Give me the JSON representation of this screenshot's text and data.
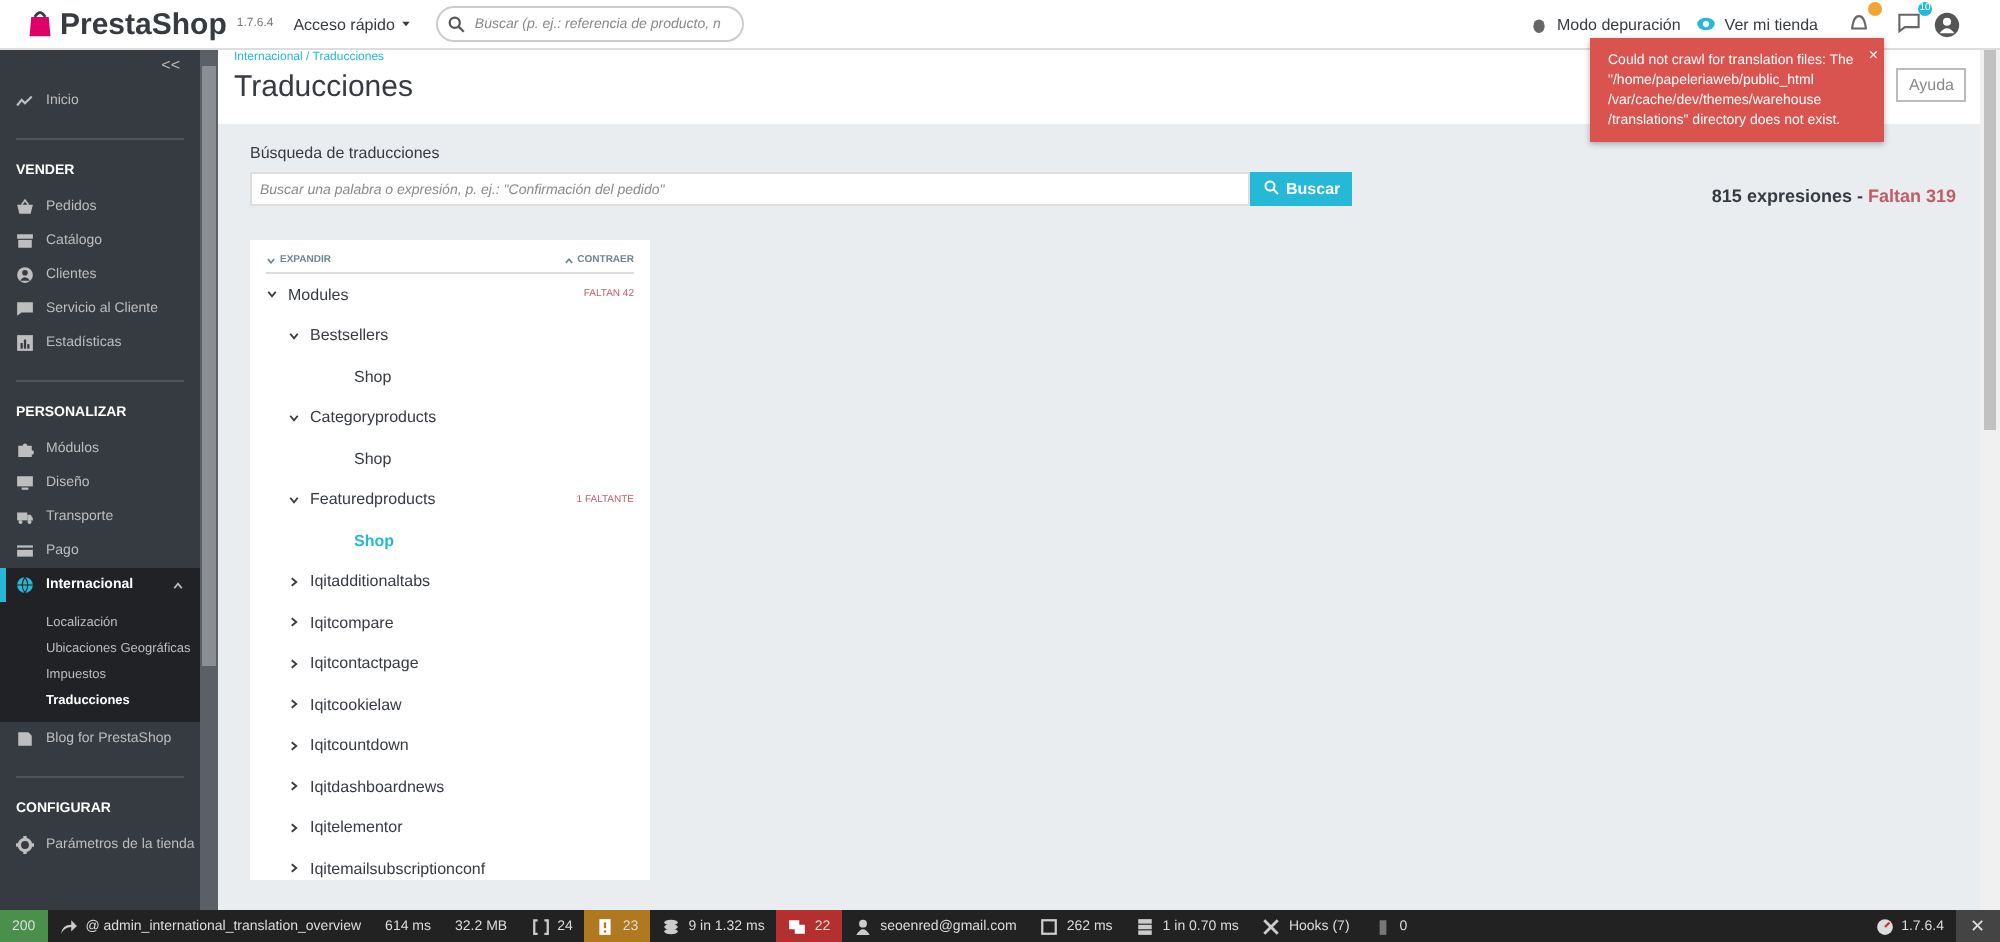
{
  "header": {
    "logo": "PrestaShop",
    "version": "1.7.6.4",
    "quick_access": "Acceso rápido",
    "search": {
      "placeholder": "Buscar (p. ej.: referencia de producto, n"
    },
    "debug_mode": "Modo depuración",
    "view_store": "Ver mi tienda",
    "notifications": [
      {
        "kind": "bell"
      },
      {
        "kind": "chat",
        "count": "10"
      }
    ]
  },
  "sidebar": {
    "collapse": "<<",
    "items": [
      {
        "kind": "item",
        "label": "Inicio",
        "selected": false
      },
      {
        "kind": "section",
        "label": "VENDER"
      },
      {
        "kind": "item",
        "label": "Pedidos",
        "selected": false
      },
      {
        "kind": "item",
        "label": "Catálogo",
        "selected": false
      },
      {
        "kind": "item",
        "label": "Clientes",
        "selected": false
      },
      {
        "kind": "item",
        "label": "Servicio al Cliente",
        "selected": false
      },
      {
        "kind": "item",
        "label": "Estadísticas",
        "selected": false
      },
      {
        "kind": "section",
        "label": "PERSONALIZAR"
      },
      {
        "kind": "item",
        "label": "Módulos",
        "selected": false
      },
      {
        "kind": "item",
        "label": "Diseño",
        "selected": false
      },
      {
        "kind": "item",
        "label": "Transporte",
        "selected": false
      },
      {
        "kind": "item",
        "label": "Pago",
        "selected": false
      },
      {
        "kind": "item",
        "label": "Internacional",
        "selected": true,
        "expanded": true,
        "children": [
          {
            "label": "Localización",
            "selected": false
          },
          {
            "label": "Ubicaciones Geográficas",
            "selected": false
          },
          {
            "label": "Impuestos",
            "selected": false
          },
          {
            "label": "Traducciones",
            "selected": true
          }
        ]
      },
      {
        "kind": "item",
        "label": "Blog for PrestaShop",
        "selected": false
      },
      {
        "kind": "section",
        "label": "CONFIGURAR"
      },
      {
        "kind": "item",
        "label": "Parámetros de la tienda",
        "selected": false
      }
    ]
  },
  "page": {
    "breadcrumb": "Internacional / Traducciones",
    "title": "Traducciones",
    "help_button": "Ayuda"
  },
  "search": {
    "label": "Búsqueda de traducciones",
    "placeholder": "Buscar una palabra o expresión, p. ej.: \"Confirmación del pedido\"",
    "button": "Buscar",
    "total": "815 expresiones - ",
    "missing": "Faltan 319"
  },
  "tree": {
    "expand": "EXPANDIR",
    "collapse": "CONTRAER",
    "nodes": [
      {
        "label": "Modules",
        "badge": "FALTAN 42",
        "expanded": true,
        "children": [
          {
            "label": "Bestsellers",
            "expanded": true,
            "children": [
              {
                "label": "Shop",
                "selected": false
              }
            ]
          },
          {
            "label": "Categoryproducts",
            "expanded": true,
            "children": [
              {
                "label": "Shop",
                "selected": false
              }
            ]
          },
          {
            "label": "Featuredproducts",
            "badge": "1 FALTANTE",
            "expanded": true,
            "children": [
              {
                "label": "Shop",
                "selected": true
              }
            ]
          },
          {
            "label": "Iqitadditionaltabs",
            "expanded": false
          },
          {
            "label": "Iqitcompare",
            "expanded": false
          },
          {
            "label": "Iqitcontactpage",
            "expanded": false
          },
          {
            "label": "Iqitcookielaw",
            "expanded": false
          },
          {
            "label": "Iqitcountdown",
            "expanded": false
          },
          {
            "label": "Iqitdashboardnews",
            "expanded": false
          },
          {
            "label": "Iqitelementor",
            "expanded": false
          },
          {
            "label": "Iqitemailsubscriptionconf",
            "expanded": false
          }
        ]
      }
    ]
  },
  "toast": {
    "message": "Could not crawl for translation files: The \"/home/papeleriaweb/public_html /var/cache/dev/themes/warehouse /translations\" directory does not exist.",
    "close": "×"
  },
  "debug_bar": {
    "items": [
      {
        "kind": "status",
        "text": "200",
        "color": "#4a8f4c"
      },
      {
        "kind": "route",
        "text": "@ admin_international_translation_overview"
      },
      {
        "kind": "plain",
        "text": "614 ms"
      },
      {
        "kind": "plain",
        "text": "32.2 MB"
      },
      {
        "kind": "forms",
        "text": "24"
      },
      {
        "kind": "warning",
        "text": "23",
        "color": "#b0781f"
      },
      {
        "kind": "db",
        "text": "9 in 1.32 ms"
      },
      {
        "kind": "security",
        "text": "22",
        "color": "#b3302f"
      },
      {
        "kind": "user",
        "text": "seoenred@gmail.com"
      },
      {
        "kind": "twig",
        "text": "262 ms"
      },
      {
        "kind": "cache",
        "text": "1 in 0.70 ms"
      },
      {
        "kind": "hooks",
        "text": "Hooks (7)"
      },
      {
        "kind": "bin",
        "text": "0"
      },
      {
        "kind": "version",
        "text": "1.7.6.4"
      },
      {
        "kind": "close",
        "text": "✕"
      }
    ]
  }
}
